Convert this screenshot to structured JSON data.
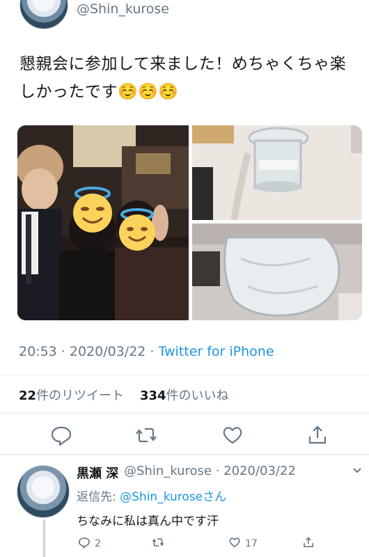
{
  "tweet": {
    "handle": "@Shin_kurose",
    "text": "懇親会に参加して来ました！めちゃくちゃ楽しかったです☺️☺️☺️",
    "timestamp": "20:53 · 2020/03/22 · ",
    "source": "Twitter for iPhone",
    "retweets_count": "22",
    "retweets_label": "件のリツイート",
    "likes_count": "334",
    "likes_label": "件のいいね"
  },
  "reply": {
    "name": "黒瀬 深",
    "handle_date": "@Shin_kurose · 2020/03/22",
    "reply_to_prefix": "返信先: ",
    "reply_to_handle": "@Shin_kurose",
    "reply_to_suffix": "さん",
    "text": "ちなみに私は真ん中です汗",
    "reply_count": "2",
    "like_count": "17"
  },
  "icons": {
    "reply": "reply-icon",
    "retweet": "retweet-icon",
    "like": "heart-icon",
    "share": "share-icon",
    "more": "chevron-down-icon"
  },
  "colors": {
    "text": "#14171a",
    "secondary": "#657786",
    "link": "#1b95e0",
    "divider": "#e6ecf0"
  }
}
